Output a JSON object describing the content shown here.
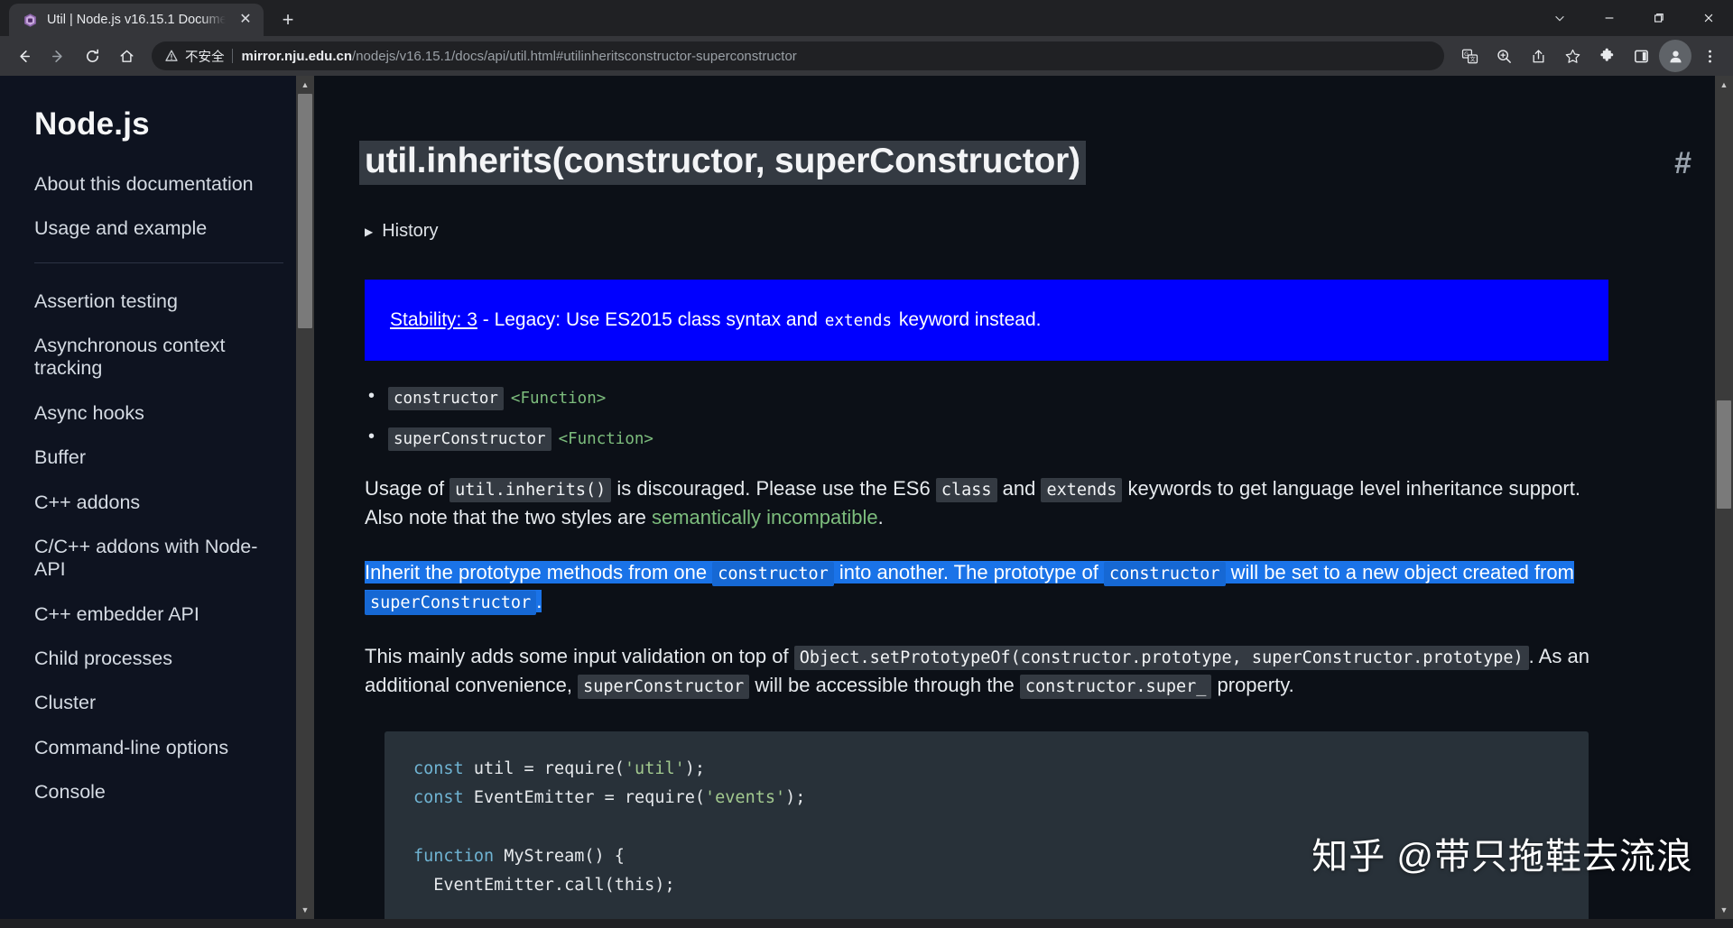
{
  "window": {
    "controls": {
      "tab_search": "tab-search-chevron",
      "minimize": "minimize",
      "maximize": "restore",
      "close": "close"
    }
  },
  "tabs": [
    {
      "title": "Util | Node.js v16.15.1 Docume",
      "favicon": "nodejs-shield-icon",
      "close_label": "✕"
    }
  ],
  "newtab_label": "+",
  "toolbar": {
    "back": "←",
    "forward": "→",
    "reload": "⟳",
    "home": "⌂",
    "security_text": "不安全",
    "url_host": "mirror.nju.edu.cn",
    "url_path": "/nodejs/v16.15.1/docs/api/util.html#utilinheritsconstructor-superconstructor",
    "url_full": "mirror.nju.edu.cn/nodejs/v16.15.1/docs/api/util.html#utilinheritsconstructor-superconstructor",
    "right_icons": [
      "translate-icon",
      "zoom-icon",
      "share-icon",
      "bookmark-star-icon",
      "extensions-puzzle-icon",
      "side-panel-icon",
      "profile-avatar-icon",
      "three-dot-menu-icon"
    ]
  },
  "sidebar": {
    "brand": "Node.js",
    "group_top": [
      {
        "label": "About this documentation"
      },
      {
        "label": "Usage and example"
      }
    ],
    "group_main": [
      {
        "label": "Assertion testing"
      },
      {
        "label": "Asynchronous context tracking"
      },
      {
        "label": "Async hooks"
      },
      {
        "label": "Buffer"
      },
      {
        "label": "C++ addons"
      },
      {
        "label": "C/C++ addons with Node-API"
      },
      {
        "label": "C++ embedder API"
      },
      {
        "label": "Child processes"
      },
      {
        "label": "Cluster"
      },
      {
        "label": "Command-line options"
      },
      {
        "label": "Console"
      }
    ]
  },
  "main": {
    "heading": "util.inherits(constructor, superConstructor)",
    "anchor_hash": "#",
    "history_label": "History",
    "stability": {
      "link_text": "Stability: 3",
      "dash": " - ",
      "text_before_code": "Legacy: Use ES2015 class syntax and ",
      "code": "extends",
      "text_after_code": " keyword instead.",
      "background_color": "#0000ff"
    },
    "params": [
      {
        "name": "constructor",
        "type": "<Function>"
      },
      {
        "name": "superConstructor",
        "type": "<Function>"
      }
    ],
    "paragraph1": {
      "p1": "Usage of ",
      "c1": "util.inherits()",
      "p2": " is discouraged. Please use the ES6 ",
      "c2": "class",
      "p3": " and ",
      "c3": "extends",
      "p4": " keywords to get language level inheritance support. Also note that the two styles are ",
      "link": "semantically incompatible",
      "p5": "."
    },
    "paragraph_selected": {
      "p1": "Inherit the prototype methods from one ",
      "c1": "constructor",
      "p2": " into another. The prototype of ",
      "c2": "constructor",
      "p3": " will be set to a new object created from ",
      "c3": "superConstructor",
      "p4": "."
    },
    "paragraph3": {
      "p1": "This mainly adds some input validation on top of ",
      "c1": "Object.setPrototypeOf(constructor.prototype, superConstructor.prototype)",
      "p2": ". As an additional convenience, ",
      "c2": "superConstructor",
      "p3": " will be accessible through the ",
      "c3": "constructor.super_",
      "p4": " property."
    },
    "code_block": {
      "lines": [
        [
          {
            "t": "const",
            "c": "k"
          },
          {
            "t": " util = require(",
            "c": ""
          },
          {
            "t": "'util'",
            "c": "s"
          },
          {
            "t": ");",
            "c": ""
          }
        ],
        [
          {
            "t": "const",
            "c": "k"
          },
          {
            "t": " EventEmitter = require(",
            "c": ""
          },
          {
            "t": "'events'",
            "c": "s"
          },
          {
            "t": ");",
            "c": ""
          }
        ],
        [
          {
            "t": "",
            "c": ""
          }
        ],
        [
          {
            "t": "function",
            "c": "k"
          },
          {
            "t": " MyStream() {",
            "c": ""
          }
        ],
        [
          {
            "t": "  EventEmitter.call(this);",
            "c": ""
          }
        ]
      ]
    },
    "watermark": "知乎 @带只拖鞋去流浪"
  },
  "colors": {
    "stability_blue": "#0000ff",
    "selection_blue": "#1a73e8",
    "sidebar_bg": "#0e1320",
    "content_bg": "#0c1017",
    "code_bg": "#283139",
    "inline_code_bg": "#343a42",
    "green_link": "#7dbd7d",
    "code_keyword": "#6fb3d2",
    "code_string": "#a2c98f"
  }
}
